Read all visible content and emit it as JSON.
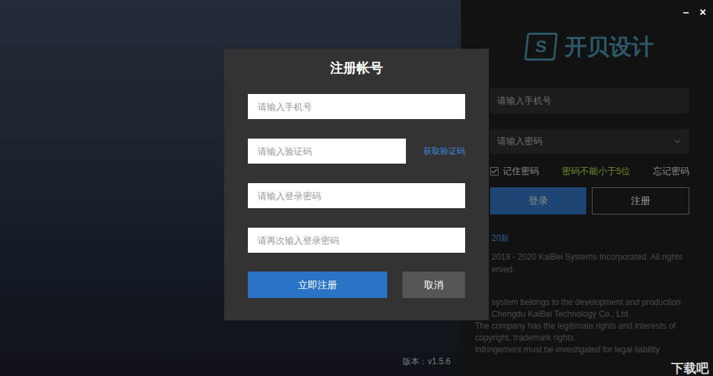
{
  "window": {
    "controls": [
      "－",
      "×"
    ]
  },
  "login_panel": {
    "logo": {
      "icon_letter": "S",
      "text": "开贝设计"
    },
    "phone_placeholder": "请输入手机号",
    "password_placeholder": "请输入密码",
    "remember": {
      "label": "记住密码",
      "checked": true
    },
    "hint": "密码不能小于5位",
    "forgot": "忘记密码",
    "buttons": [
      {
        "label": "登录",
        "primary": true
      },
      {
        "label": "注册",
        "primary": false
      }
    ],
    "version_note": "20新",
    "copyright": [
      "2019 - 2020 KaiBei Systems Incorporated. All rights",
      "erved."
    ],
    "notice": [
      {
        "text": "system belongs to the development and production",
        "indented": true
      },
      {
        "text": "Chengdu KaiBei Technology Co., Ltd.",
        "indented": true
      },
      {
        "text": "The company has the legitimate rights and interests of",
        "indented": false
      },
      {
        "text": "copyright, trademark rights.",
        "indented": false
      },
      {
        "text": "Infringement must be investigated for legal liability",
        "indented": false
      }
    ]
  },
  "background": {
    "version": "版本：v1.5.6"
  },
  "dialog": {
    "title": "注册帐号",
    "fields": [
      {
        "placeholder": "请输入手机号",
        "kind": "text"
      },
      {
        "placeholder": "请输入验证码",
        "kind": "code",
        "action": "获取验证码"
      },
      {
        "placeholder": "请输入登录密码",
        "kind": "text"
      },
      {
        "placeholder": "请再次输入登录密码",
        "kind": "text"
      }
    ],
    "buttons": [
      {
        "label": "立即注册",
        "primary": true
      },
      {
        "label": "取消",
        "primary": false
      }
    ]
  },
  "watermark": {
    "text": "下载吧"
  }
}
